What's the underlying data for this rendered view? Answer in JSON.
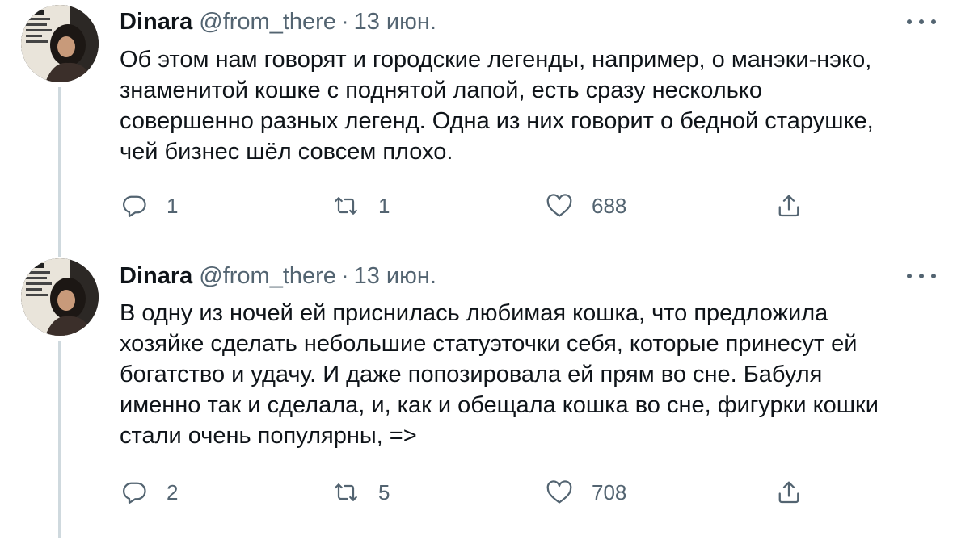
{
  "tweets": [
    {
      "author_name": "Dinara",
      "handle": "@from_there",
      "separator": "·",
      "date": "13 июн.",
      "text": "Об этом нам говорят и городские легенды, например, о манэки-нэко,\nзнаменитой кошке с поднятой лапой, есть сразу несколько\nсовершенно разных легенд. Одна из них говорит о бедной старушке,\nчей бизнес шёл совсем плохо.",
      "replies": "1",
      "retweets": "1",
      "likes": "688"
    },
    {
      "author_name": "Dinara",
      "handle": "@from_there",
      "separator": "·",
      "date": "13 июн.",
      "text": "В одну из ночей ей приснилась любимая кошка, что предложила\nхозяйке сделать небольшие статуэточки себя, которые принесут ей\nбогатство и удачу. И даже попозировала ей прям во сне. Бабуля\nименно так и сделала, и, как и обещала кошка во сне, фигурки кошки\nстали очень популярны, =>",
      "replies": "2",
      "retweets": "5",
      "likes": "708"
    }
  ],
  "icons": {
    "reply": "reply-icon",
    "retweet": "retweet-icon",
    "like": "heart-icon",
    "share": "share-icon",
    "more": "more-options-icon"
  },
  "colors": {
    "text": "#0f1419",
    "muted": "#536471",
    "thread_line": "#cfd9de",
    "background": "#ffffff"
  }
}
